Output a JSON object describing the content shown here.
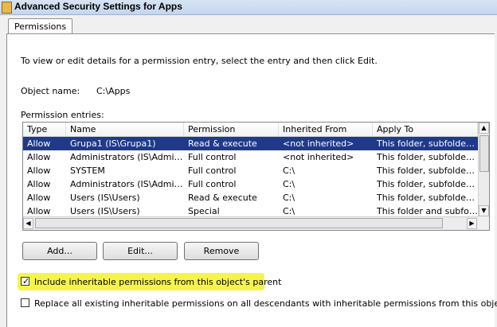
{
  "window": {
    "title": "Advanced Security Settings for Apps"
  },
  "tabs": [
    {
      "label": "Permissions"
    }
  ],
  "intro_text": "To view or edit details for a permission entry, select the entry and then click Edit.",
  "object_name": {
    "label": "Object name:",
    "value": "C:\\Apps"
  },
  "permission_entries": {
    "label": "Permission entries:",
    "columns": [
      "Type",
      "Name",
      "Permission",
      "Inherited From",
      "Apply To"
    ],
    "rows": [
      [
        "Allow",
        "Grupa1 (IS\\Grupa1)",
        "Read & execute",
        "<not inherited>",
        "This folder, subfolders a…"
      ],
      [
        "Allow",
        "Administrators (IS\\Admin…",
        "Full control",
        "<not inherited>",
        "This folder, subfolders a…"
      ],
      [
        "Allow",
        "SYSTEM",
        "Full control",
        "C:\\",
        "This folder, subfolders a…"
      ],
      [
        "Allow",
        "Administrators (IS\\Admin…",
        "Full control",
        "C:\\",
        "This folder, subfolders a…"
      ],
      [
        "Allow",
        "Users (IS\\Users)",
        "Read & execute",
        "C:\\",
        "This folder, subfolders a…"
      ],
      [
        "Allow",
        "Users (IS\\Users)",
        "Special",
        "C:\\",
        "This folder and subfolders"
      ]
    ],
    "selected_row": 0
  },
  "buttons": {
    "add": "Add...",
    "edit": "Edit...",
    "remove": "Remove"
  },
  "checkboxes": {
    "include_inheritable": {
      "label": "Include inheritable permissions from this object's parent",
      "checked": true
    },
    "replace_all": {
      "label": "Replace all existing inheritable permissions on all descendants with inheritable permissions from this object",
      "checked": false
    }
  },
  "colors": {
    "selection": "#1f3a8a",
    "highlight": "#f6f44a"
  }
}
